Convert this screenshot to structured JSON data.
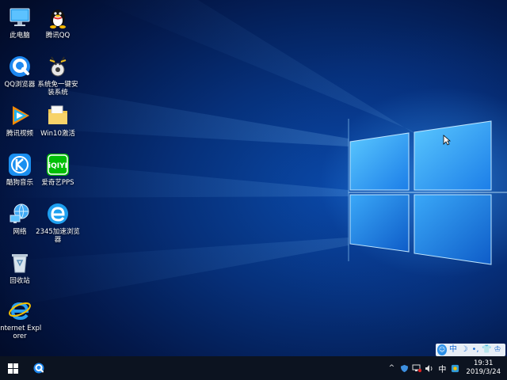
{
  "desktop": {
    "icons": [
      {
        "label": "此电脑"
      },
      {
        "label": "腾讯QQ"
      },
      {
        "label": "QQ浏览器"
      },
      {
        "label": "系统免一键安装系统"
      },
      {
        "label": "腾讯视频"
      },
      {
        "label": "Win10激活"
      },
      {
        "label": "酷狗音乐"
      },
      {
        "label": "爱奇艺PPS"
      },
      {
        "label": "网络"
      },
      {
        "label": "2345加速浏览器"
      },
      {
        "label": "回收站"
      },
      {
        "label": "Internet Explorer"
      }
    ]
  },
  "ime_toolbar": {
    "mode": "中",
    "moon": "☽",
    "punct": "•,",
    "shirt": "👕",
    "skin": "♔"
  },
  "taskbar": {
    "tray": {
      "ime": "中",
      "overflow": "^"
    },
    "clock": {
      "time": "19:31",
      "date": "2019/3/24"
    }
  },
  "colors": {
    "taskbar": "#0c1320",
    "accent": "#1a8ff0"
  }
}
